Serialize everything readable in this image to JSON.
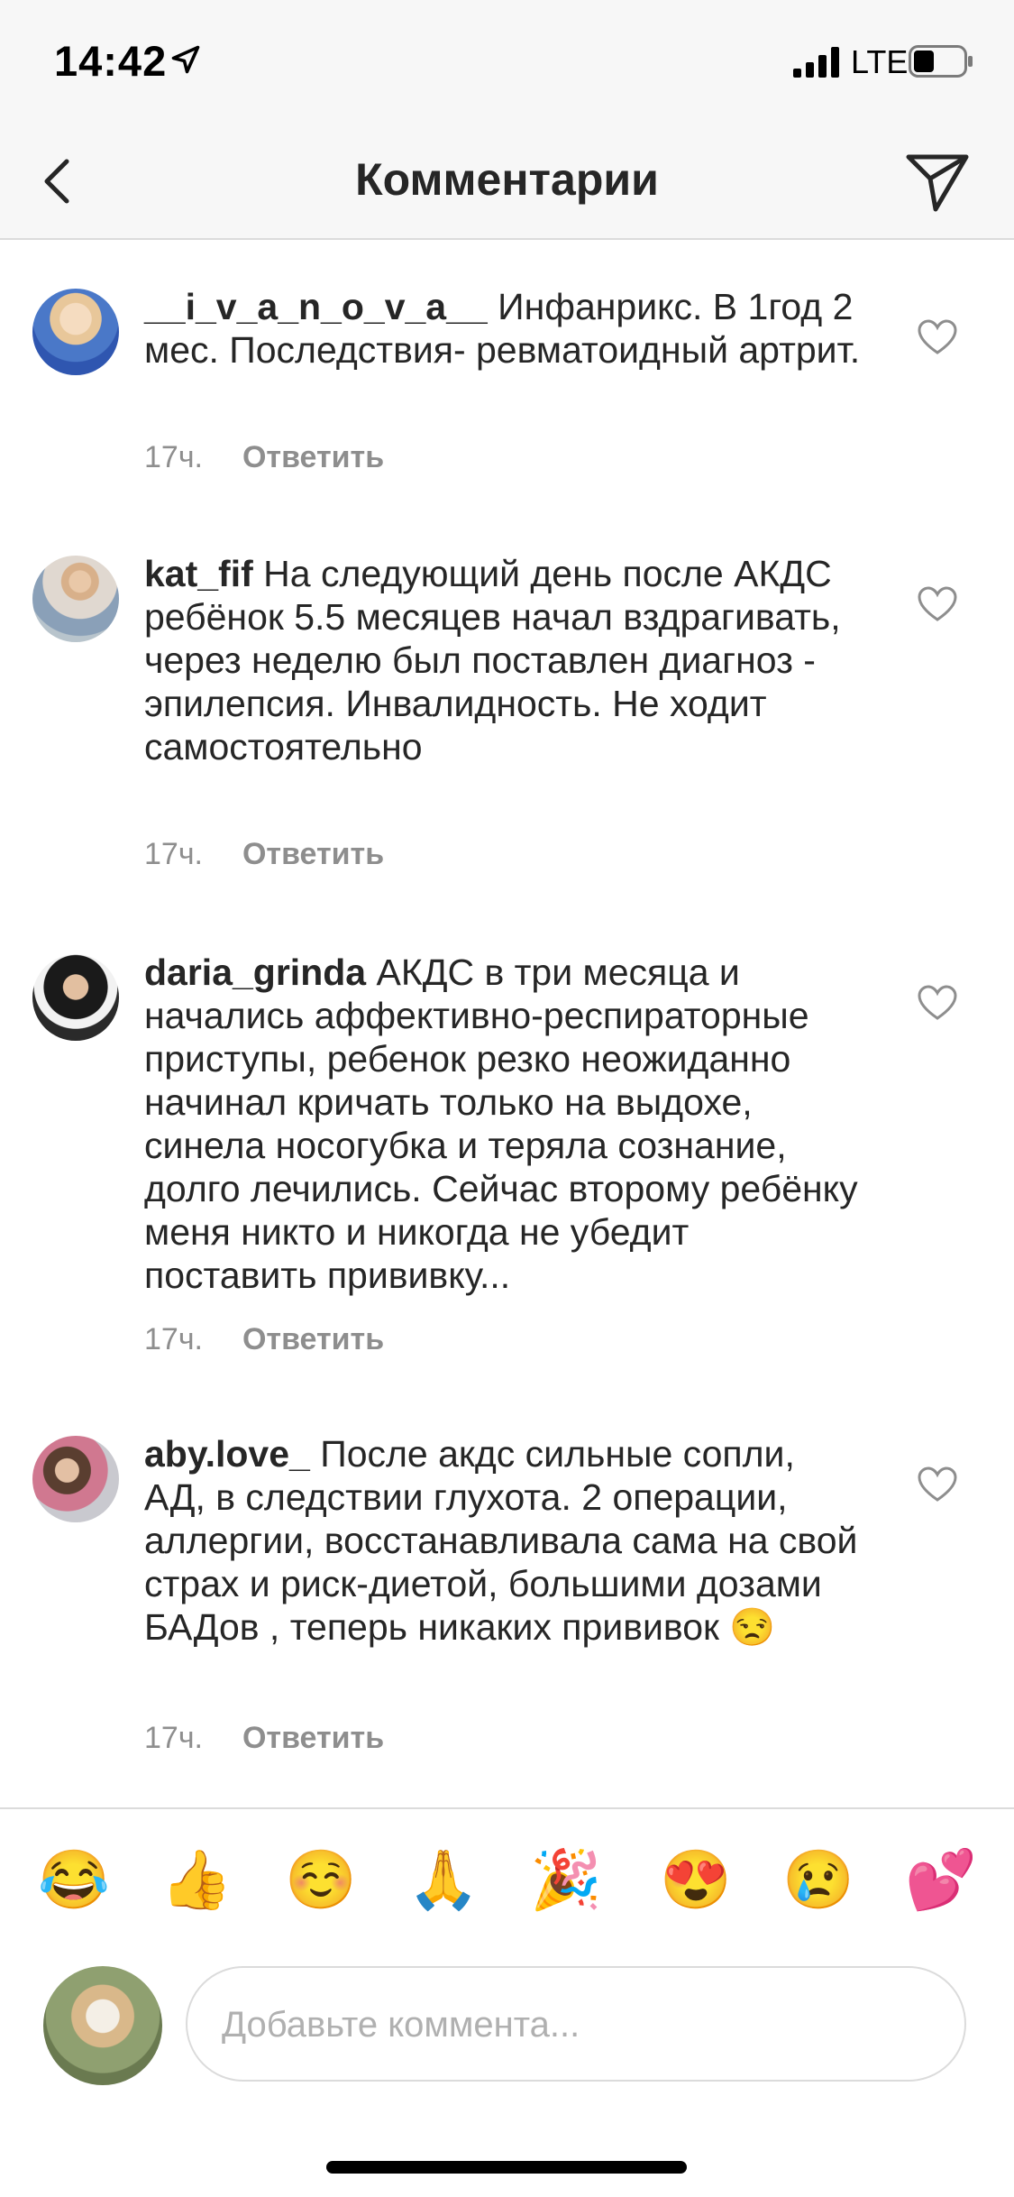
{
  "status_bar": {
    "time": "14:42",
    "network": "LTE",
    "icons": [
      "location-arrow-icon",
      "signal-bars-icon",
      "battery-icon"
    ]
  },
  "header": {
    "title": "Комментарии",
    "back_icon": "chevron-left-icon",
    "send_icon": "paper-plane-icon"
  },
  "comments": [
    {
      "username": "__i_v_a_n_o_v_a__",
      "text": " Инфанрикс. В 1год 2 мес. Последствия- ревматоидный артрит.",
      "time": "17ч.",
      "reply": "Ответить"
    },
    {
      "username": "kat_fif",
      "text": " На следующий день после АКДС ребёнок 5.5 месяцев начал вздрагивать, через неделю был поставлен диагноз - эпилепсия. Инвалидность. Не ходит самостоятельно",
      "time": "17ч.",
      "reply": "Ответить"
    },
    {
      "username": "daria_grinda",
      "text": " АКДС в три месяца и начались аффективно-респираторные приступы, ребенок резко неожиданно начинал кричать только на выдохе, синела носогубка и теряла сознание, долго лечились. Сейчас второму ребёнку меня никто и никогда не убедит поставить прививку...",
      "time": "17ч.",
      "reply": "Ответить"
    },
    {
      "username": "aby.love_",
      "text": " После акдс сильные сопли, АД, в следствии глухота. 2 операции, аллергии, восстанавливала сама на свой страх и риск-диетой, большими дозами БАДов , теперь никаких прививок 😒",
      "time": "17ч.",
      "reply": "Ответить"
    }
  ],
  "emoji_bar": [
    "😂",
    "👍",
    "☺️",
    "🙏",
    "🎉",
    "😍",
    "😢",
    "💕"
  ],
  "input": {
    "placeholder": "Добавьте коммента..."
  },
  "colors": {
    "text": "#262626",
    "secondary": "#8e8e8e",
    "divider": "#dbdbdb",
    "bar_background": "#f7f7f7"
  }
}
